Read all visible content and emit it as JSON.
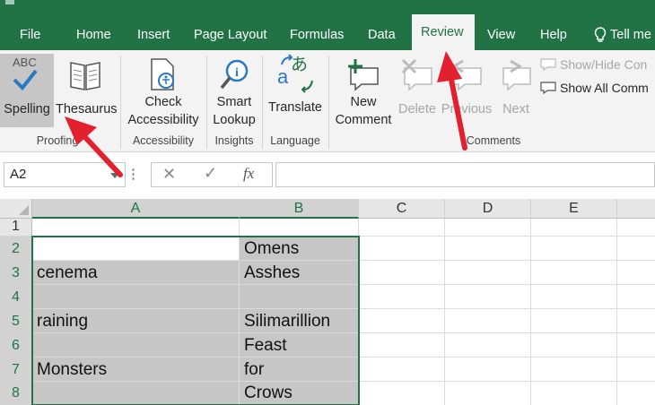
{
  "tabs": [
    "File",
    "Home",
    "Insert",
    "Page Layout",
    "Formulas",
    "Data",
    "Review",
    "View",
    "Help"
  ],
  "active_tab": "Review",
  "tell_me": "Tell me",
  "ribbon": {
    "spelling_abc": "ABC",
    "spelling": "Spelling",
    "thesaurus": "Thesaurus",
    "check_1": "Check",
    "check_2": "Accessibility",
    "smart_1": "Smart",
    "smart_2": "Lookup",
    "translate": "Translate",
    "translate_glyph": "あ",
    "translate_a": "a",
    "new_1": "New",
    "new_2": "Comment",
    "delete": "Delete",
    "previous": "Previous",
    "next": "Next",
    "show_hide": "Show/Hide Con",
    "show_all": "Show All Comm",
    "groups": {
      "proofing": "Proofing",
      "accessibility": "Accessibility",
      "insights": "Insights",
      "language": "Language",
      "comments": "Comments"
    }
  },
  "formula_bar": {
    "name_box": "A2",
    "fx": "fx",
    "formula": ""
  },
  "columns": [
    "A",
    "B",
    "C",
    "D",
    "E"
  ],
  "rows": [
    "1",
    "2",
    "3",
    "4",
    "5",
    "6",
    "7",
    "8"
  ],
  "cells": {
    "A": [
      "",
      "",
      "cenema",
      "",
      "raining",
      "",
      "Monsters",
      ""
    ],
    "B": [
      "",
      "Omens",
      "Asshes",
      "",
      "Silimarillion",
      "Feast",
      "for",
      "Crows"
    ]
  },
  "colors": {
    "accent": "#217346",
    "annotation_arrow": "#e3212e",
    "selection": "#c6c6c6"
  }
}
